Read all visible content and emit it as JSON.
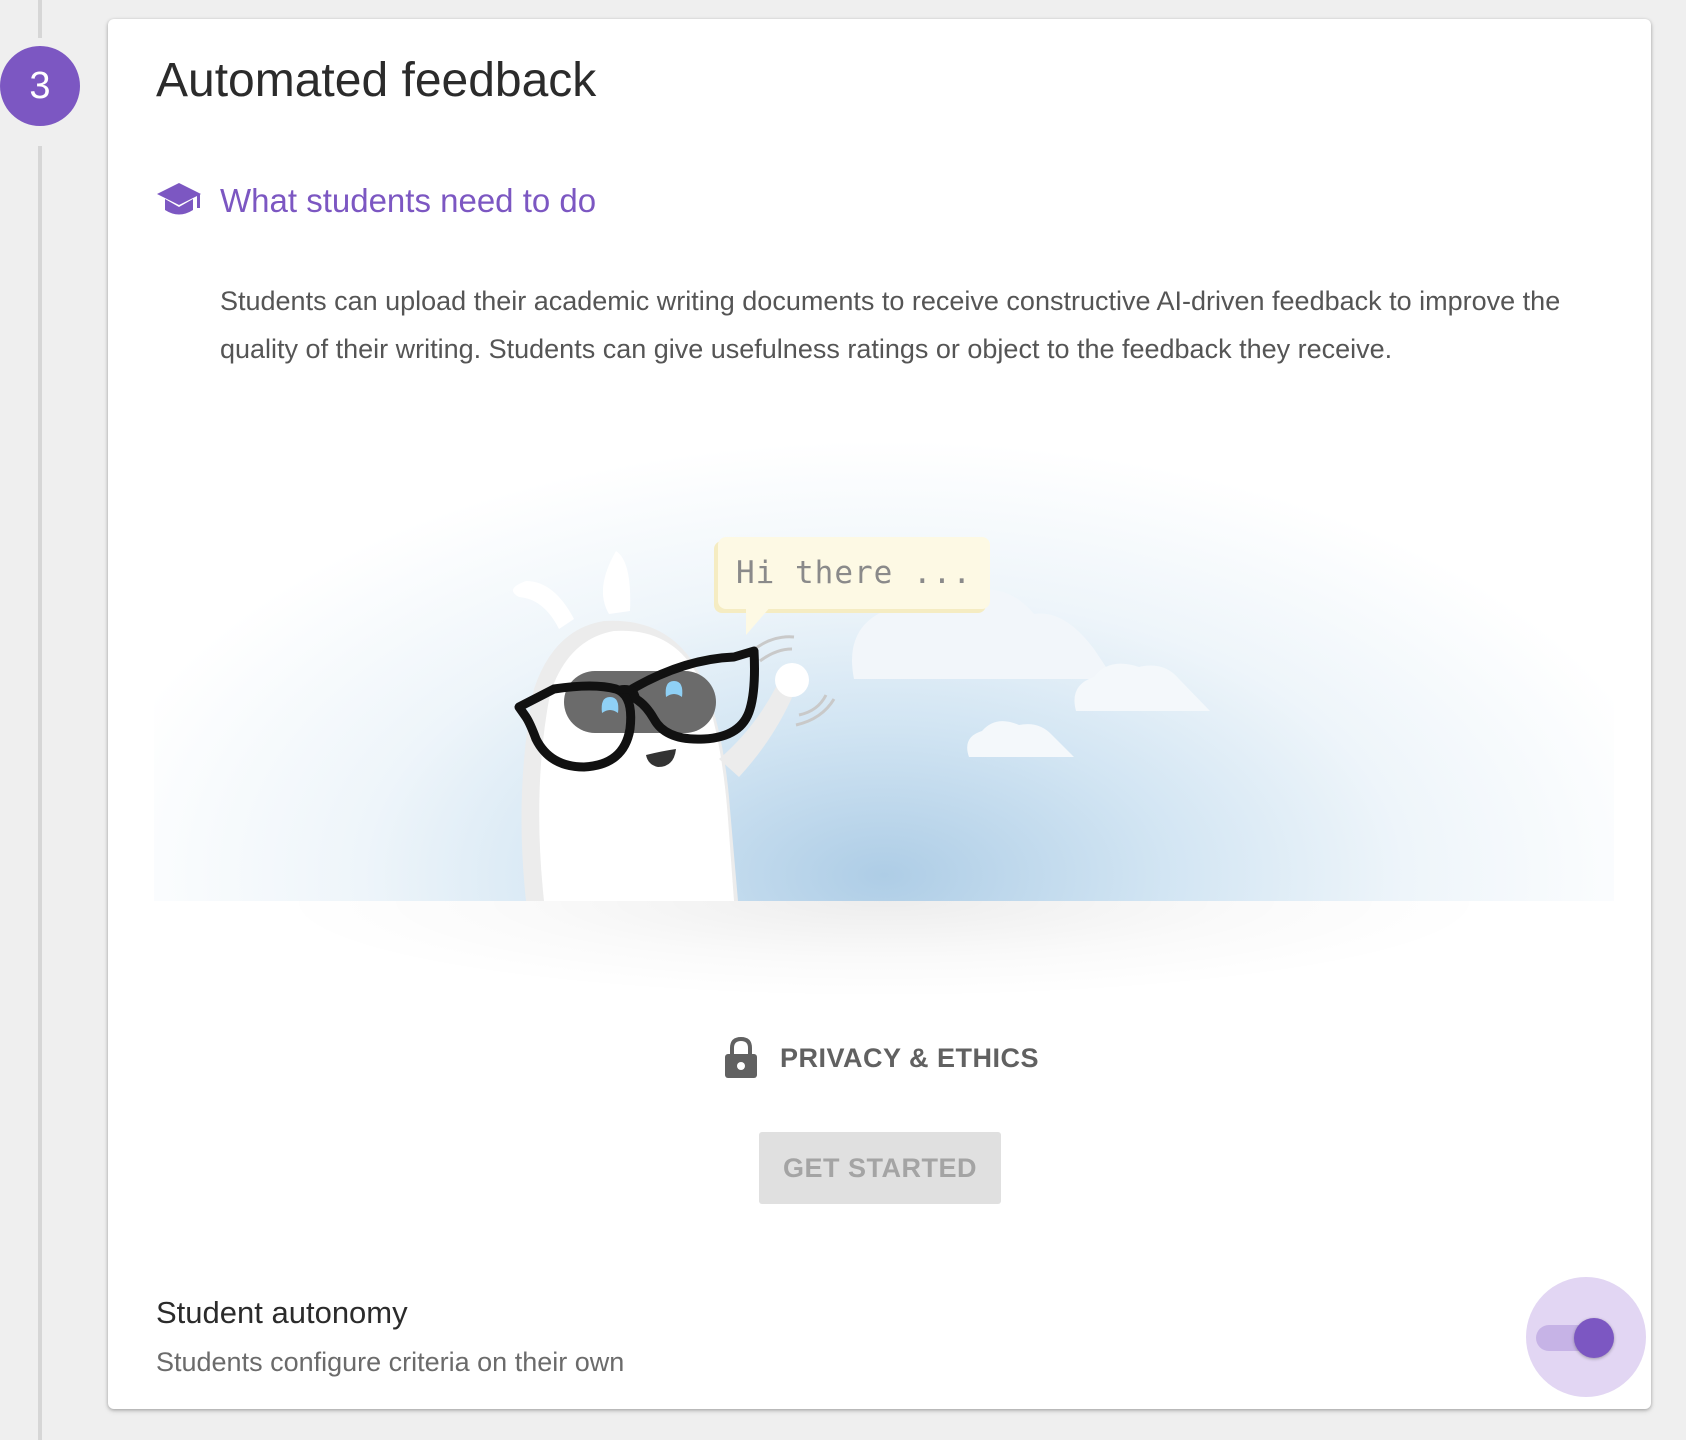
{
  "step": {
    "number": "3",
    "color": "#7c57c2"
  },
  "card": {
    "title": "Automated feedback",
    "section": {
      "icon": "graduation-cap-icon",
      "heading": "What students need to do",
      "description": "Students can upload their academic writing documents to receive constructive AI-driven feedback to improve the quality of their writing. Students can give usefulness ratings or object to the feedback they receive."
    },
    "illustration": {
      "speech": "Hi there ..."
    },
    "privacy": {
      "icon": "lock-icon",
      "label": "PRIVACY & ETHICS"
    },
    "get_started": {
      "label": "GET STARTED",
      "disabled": true
    },
    "autonomy": {
      "title": "Student autonomy",
      "subtitle": "Students configure criteria on their own",
      "enabled": true
    }
  },
  "colors": {
    "accent": "#7c57c2",
    "background": "#efefef",
    "card": "#ffffff",
    "button_disabled_bg": "#e0e0e0",
    "button_disabled_text": "#a4a4a4"
  }
}
